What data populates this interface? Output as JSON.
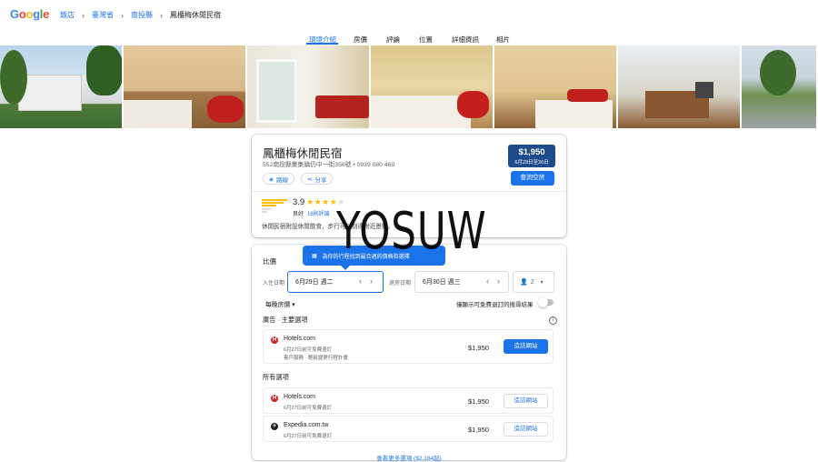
{
  "header": {
    "logo": "Google",
    "breadcrumbs": [
      {
        "label": "飯店"
      },
      {
        "label": "臺灣省"
      },
      {
        "label": "南投縣"
      },
      {
        "label": "鳳櫃梅休閒民宿"
      }
    ]
  },
  "tabs": [
    "環境介紹",
    "房價",
    "評論",
    "位置",
    "詳細資訊",
    "相片"
  ],
  "hotel": {
    "name": "鳳櫃梅休閒民宿",
    "address": "552南投縣集集鎮仍中一街356號 • 0939 080 469",
    "price": "$1,950",
    "price_dates": "6月29日至30日",
    "check_label": "查詢空房",
    "route_label": "路線",
    "share_label": "分享",
    "rating": "3.9",
    "rating_value": 3.9,
    "rating_word": "良好",
    "reviews": "16則評論",
    "description": "休閒民宿附設休閒飲食，步行可以到達附近景點。"
  },
  "watermark": "YOSUW",
  "prices": {
    "title": "比價",
    "tooltip": "為你的行程找到最合適的價格和選擇",
    "checkin_label": "入住日期",
    "checkin_value": "6月29日 週二",
    "checkout_label": "退房日期",
    "checkout_value": "6月30日 週三",
    "guests": "2",
    "nightly": "每晚房價 ▾",
    "free_cancel": "僅顯示可免費退訂的搜尋結果",
    "ads_header": "廣告 · 主要選項",
    "all_header": "所有選項",
    "more": "查看更多選項 ($2,184起)",
    "ad_rows": [
      {
        "provider": "Hotels.com",
        "line1": "6月27日前可免費退訂",
        "line2": "客戶服務 · 輕鬆變更行程計畫",
        "price": "$1,950",
        "button": "造訪網站"
      }
    ],
    "rows": [
      {
        "provider": "Hotels.com",
        "line1": "6月27日前可免費退訂",
        "price": "$1,950",
        "button": "造訪網站"
      },
      {
        "provider": "Expedia.com.tw",
        "line1": "6月27日前可免費退訂",
        "price": "$1,950",
        "button": "造訪網站"
      }
    ]
  },
  "colors": {
    "accent": "#1a73e8",
    "price_box": "#1e4b8e",
    "star": "#fbbc04"
  }
}
